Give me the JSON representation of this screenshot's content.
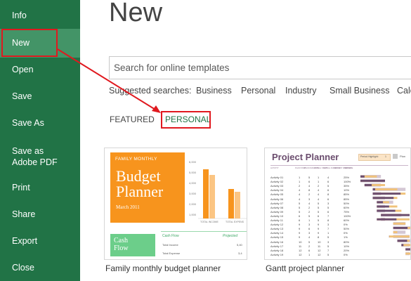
{
  "sidebar": {
    "items": [
      {
        "label": "Info"
      },
      {
        "label": "New"
      },
      {
        "label": "Open"
      },
      {
        "label": "Save"
      },
      {
        "label": "Save As"
      },
      {
        "label": "Save as Adobe PDF"
      },
      {
        "label": "Print"
      },
      {
        "label": "Share"
      },
      {
        "label": "Export"
      },
      {
        "label": "Close"
      }
    ]
  },
  "main": {
    "title": "New",
    "search_placeholder": "Search for online templates",
    "suggested_label": "Suggested searches:",
    "suggested": [
      "Business",
      "Personal",
      "Industry",
      "Small Business",
      "Calc"
    ],
    "tabs": [
      {
        "label": "FEATURED"
      },
      {
        "label": "PERSONAL"
      }
    ],
    "templates": [
      {
        "name": "Family monthly budget planner",
        "thumb": {
          "header": "FAMILY MONTHLY",
          "title_line1": "Budget",
          "title_line2": "Planner",
          "date": "March 2011",
          "cash_flow_line1": "Cash",
          "cash_flow_line2": "Flow",
          "table_header": "Cash Flow",
          "table_col": "Projected",
          "rows": [
            {
              "label": "Total Income",
              "value": "5,40"
            },
            {
              "label": "Total Expense",
              "value": "3,4"
            }
          ],
          "y_ticks": [
            "6,000",
            "5,000",
            "4,000",
            "3,000",
            "2,000",
            "1,000",
            "0"
          ],
          "x_labels": [
            "TOTAL INCOME",
            "TOTAL EXPENS"
          ]
        }
      },
      {
        "name": "Gantt project planner",
        "thumb": {
          "title": "Project Planner",
          "highlight_label": "Period Highlight:",
          "highlight_value": "1",
          "plan_label": "Plan",
          "columns": [
            "ACTIVITY",
            "PLAN START",
            "PLAN DURATION",
            "ACTUAL START",
            "ACTUAL DURATION",
            "PERCENT COMPLETE",
            "PERIODS"
          ],
          "activities": [
            {
              "name": "Activity 01",
              "ps": "1",
              "pd": "5",
              "as": "1",
              "ad": "4",
              "pc": "25%"
            },
            {
              "name": "Activity 02",
              "ps": "1",
              "pd": "6",
              "as": "1",
              "ad": "6",
              "pc": "100%"
            },
            {
              "name": "Activity 03",
              "ps": "2",
              "pd": "4",
              "as": "2",
              "ad": "5",
              "pc": "35%"
            },
            {
              "name": "Activity 04",
              "ps": "4",
              "pd": "8",
              "as": "4",
              "ad": "6",
              "pc": "10%"
            },
            {
              "name": "Activity 05",
              "ps": "4",
              "pd": "2",
              "as": "4",
              "ad": "8",
              "pc": "85%"
            },
            {
              "name": "Activity 06",
              "ps": "4",
              "pd": "3",
              "as": "4",
              "ad": "6",
              "pc": "85%"
            },
            {
              "name": "Activity 07",
              "ps": "5",
              "pd": "4",
              "as": "5",
              "ad": "3",
              "pc": "50%"
            },
            {
              "name": "Activity 08",
              "ps": "5",
              "pd": "2",
              "as": "5",
              "ad": "5",
              "pc": "60%"
            },
            {
              "name": "Activity 09",
              "ps": "5",
              "pd": "2",
              "as": "5",
              "ad": "6",
              "pc": "75%"
            },
            {
              "name": "Activity 10",
              "ps": "6",
              "pd": "5",
              "as": "6",
              "ad": "7",
              "pc": "100%"
            },
            {
              "name": "Activity 11",
              "ps": "6",
              "pd": "1",
              "as": "5",
              "ad": "8",
              "pc": "60%"
            },
            {
              "name": "Activity 12",
              "ps": "9",
              "pd": "3",
              "as": "9",
              "ad": "3",
              "pc": "0%"
            },
            {
              "name": "Activity 13",
              "ps": "9",
              "pd": "6",
              "as": "9",
              "ad": "7",
              "pc": "50%"
            },
            {
              "name": "Activity 14",
              "ps": "9",
              "pd": "3",
              "as": "9",
              "ad": "1",
              "pc": "0%"
            },
            {
              "name": "Activity 15",
              "ps": "9",
              "pd": "4",
              "as": "8",
              "ad": "5",
              "pc": "1%"
            },
            {
              "name": "Activity 16",
              "ps": "10",
              "pd": "5",
              "as": "10",
              "ad": "3",
              "pc": "80%"
            },
            {
              "name": "Activity 17",
              "ps": "11",
              "pd": "2",
              "as": "11",
              "ad": "5",
              "pc": "10%"
            },
            {
              "name": "Activity 18",
              "ps": "12",
              "pd": "6",
              "as": "12",
              "ad": "7",
              "pc": "20%"
            },
            {
              "name": "Activity 19",
              "ps": "12",
              "pd": "1",
              "as": "12",
              "ad": "5",
              "pc": "0%"
            }
          ]
        }
      }
    ]
  },
  "colors": {
    "sidebar_bg": "#217346",
    "sidebar_selected": "#439467",
    "annotation": "#e0191f",
    "budget_orange": "#f7941d",
    "budget_green": "#6cce8a",
    "gantt_purple": "#6b4d6e"
  }
}
